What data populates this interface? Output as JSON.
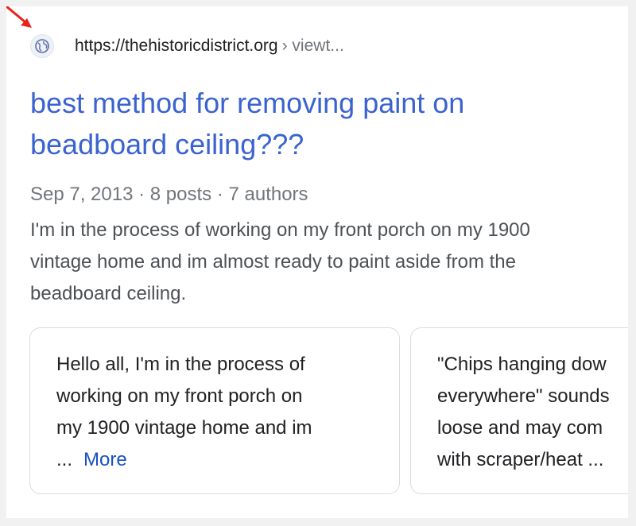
{
  "result": {
    "url": "https://thehistoricdistrict.org",
    "breadcrumb": "› viewt...",
    "title_line1": "best method for removing paint on",
    "title_line2": "beadboard ceiling???",
    "meta": "Sep 7, 2013 · 8 posts · 7 authors",
    "snippet": "I'm in the process of working on my front porch on my 1900 vintage home and im almost ready to paint aside from the beadboard ceiling."
  },
  "sub_results": [
    {
      "line1": "Hello all, I'm in the process of",
      "line2": "working on my front porch on",
      "line3": "my 1900 vintage home and im",
      "line4": "...",
      "more_label": "More"
    },
    {
      "line1": "\"Chips hanging dow",
      "line2": "everywhere\" sounds",
      "line3": "loose and may com",
      "line4": "with scraper/heat ..."
    }
  ],
  "icons": {
    "favicon": "globe-icon",
    "annotation": "red-arrow-icon"
  },
  "colors": {
    "title": "#3b63cf",
    "arrow": "#e8231b",
    "more": "#1a4fc7"
  }
}
